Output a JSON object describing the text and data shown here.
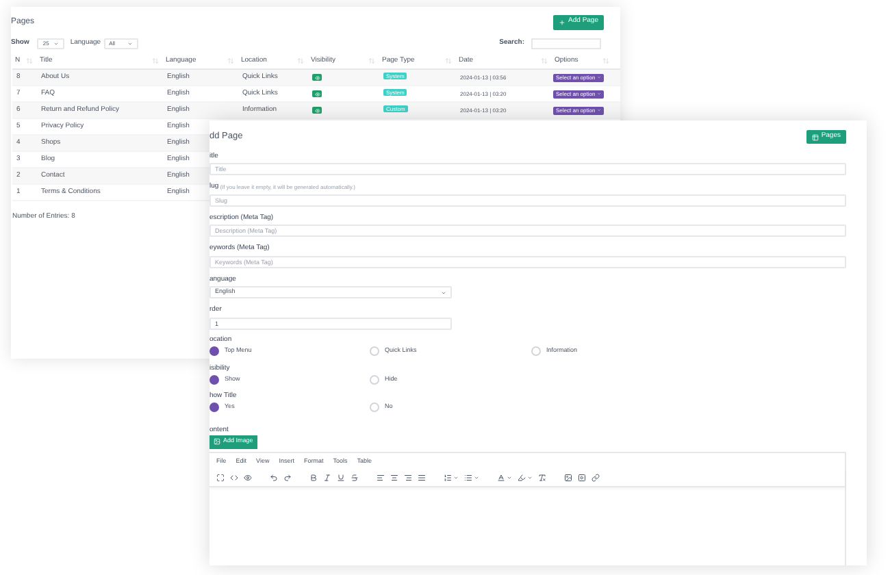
{
  "pages_panel": {
    "title": "Pages",
    "add_button": "Add Page",
    "show_label": "Show",
    "show_value": "25",
    "language_label": "Language",
    "language_value": "All",
    "search_label": "Search:",
    "columns": [
      "N",
      "Title",
      "Language",
      "Location",
      "Visibility",
      "Page Type",
      "Date",
      "Options"
    ],
    "rows": [
      {
        "kind": "full",
        "number": "8",
        "title": "About Us",
        "language": "English",
        "location": "Quick Links",
        "page_type": "System",
        "date": "2024-01-13 | 03:56",
        "option": "Select an option"
      },
      {
        "kind": "full",
        "number": "7",
        "title": "FAQ",
        "language": "English",
        "location": "Quick Links",
        "page_type": "System",
        "date": "2024-01-13 | 03:20",
        "option": "Select an option"
      },
      {
        "kind": "full",
        "number": "6",
        "title": "Return and Refund Policy",
        "language": "English",
        "location": "Information",
        "page_type": "Custom",
        "date": "2024-01-13 | 03:20",
        "option": "Select an option"
      },
      {
        "kind": "covered",
        "number": "5",
        "title": "Privacy Policy",
        "language": "English"
      },
      {
        "kind": "covered",
        "number": "4",
        "title": "Shops",
        "language": "English"
      },
      {
        "kind": "covered",
        "number": "3",
        "title": "Blog",
        "language": "English"
      },
      {
        "kind": "covered",
        "number": "2",
        "title": "Contact",
        "language": "English"
      },
      {
        "kind": "covered",
        "number": "1",
        "title": "Terms & Conditions",
        "language": "English"
      }
    ],
    "footer": "Number of Entries: 8"
  },
  "form": {
    "title": "dd Page",
    "pages_button": "Pages",
    "fields": [
      {
        "kind": "text",
        "label": "itle",
        "placeholder": "Title"
      },
      {
        "kind": "text",
        "label": "lug",
        "hint": "(If you leave it empty, it will be generated automatically.)",
        "placeholder": "Slug"
      },
      {
        "kind": "text",
        "label": "escription (Meta Tag)",
        "placeholder": "Description (Meta Tag)"
      },
      {
        "kind": "text",
        "label": "eywords (Meta Tag)",
        "placeholder": "Keywords (Meta Tag)"
      },
      {
        "kind": "select",
        "label": "anguage",
        "value": "English"
      },
      {
        "kind": "number",
        "label": "rder",
        "value": "1"
      }
    ],
    "radio_groups": [
      {
        "label": "ocation",
        "options": [
          {
            "label": "Top Menu",
            "selected": true
          },
          {
            "label": "Quick Links",
            "selected": false
          },
          {
            "label": "Information",
            "selected": false
          }
        ]
      },
      {
        "label": "isibility",
        "options": [
          {
            "label": "Show",
            "selected": true
          },
          {
            "label": "Hide",
            "selected": false
          }
        ]
      },
      {
        "label": "how Title",
        "options": [
          {
            "label": "Yes",
            "selected": true
          },
          {
            "label": "No",
            "selected": false
          }
        ]
      }
    ],
    "content_label": "ontent",
    "add_image": "Add Image",
    "editor_menu": [
      "File",
      "Edit",
      "View",
      "Insert",
      "Format",
      "Tools",
      "Table"
    ]
  }
}
